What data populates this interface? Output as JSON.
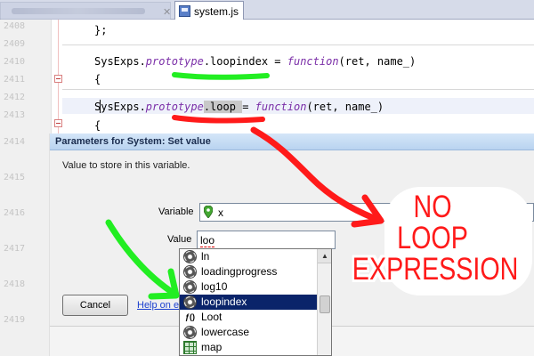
{
  "editor": {
    "tab_label": "system.js",
    "line_numbers": [
      "2408",
      "2409",
      "2410",
      "2411",
      "2412",
      "2413",
      "2414",
      "2415",
      "2416",
      "2417",
      "2418",
      "2419"
    ],
    "code": {
      "line1": "};",
      "line2_obj": "SysExps.",
      "line2_kw": "prototype",
      "line2_rest": ".loopindex = ",
      "line2_kw2": "function",
      "line2_args": "(ret, name_)",
      "line3": "{",
      "line4_obj": "SysExps.",
      "line4_kw": "prototype",
      "line4_sel": ".loop ",
      "line4_mid": "= ",
      "line4_kw2": "function",
      "line4_args": "(ret, name_)",
      "line5": "{"
    }
  },
  "dialog": {
    "title": "Parameters for System: Set value",
    "description": "Value to store in this variable.",
    "variable_label": "Variable",
    "variable_value": "x",
    "value_label": "Value",
    "value_text": "loo",
    "cancel_label": "Cancel",
    "help_label": "Help on expressions"
  },
  "autocomplete": {
    "items": [
      {
        "label": "ln",
        "icon": "gear-icon"
      },
      {
        "label": "loadingprogress",
        "icon": "gear-icon"
      },
      {
        "label": "log10",
        "icon": "gear-icon"
      },
      {
        "label": "loopindex",
        "icon": "gear-icon",
        "selected": true
      },
      {
        "label": "Loot",
        "icon": "function-icon"
      },
      {
        "label": "lowercase",
        "icon": "gear-icon"
      },
      {
        "label": "map",
        "icon": "grid-icon"
      }
    ]
  },
  "annotation": {
    "line1": "NO",
    "line2": "LOOP",
    "line3": "EXPRESSION",
    "color": "#ff1a1a",
    "green": "#22ee22"
  }
}
